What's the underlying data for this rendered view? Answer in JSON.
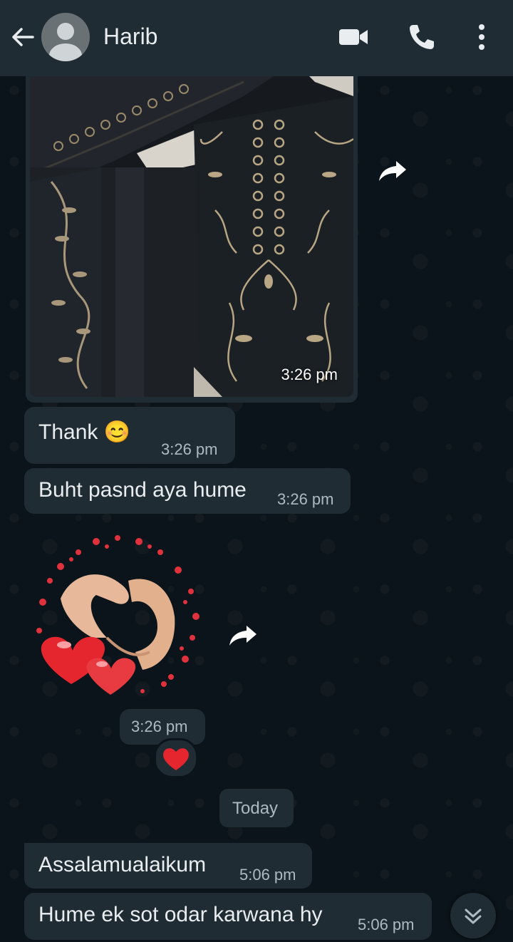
{
  "header": {
    "contact_name": "Harib",
    "icons": [
      "back-arrow-icon",
      "avatar",
      "video-call-icon",
      "voice-call-icon",
      "more-options-icon"
    ]
  },
  "messages": [
    {
      "type": "image",
      "time": "3:26 pm",
      "description_icon": "embroidered-fabric-photo"
    },
    {
      "type": "text",
      "text": "Thank 😊",
      "time": "3:26 pm"
    },
    {
      "type": "text",
      "text": "Buht pasnd aya hume",
      "time": "3:26 pm"
    },
    {
      "type": "sticker",
      "time": "3:26 pm",
      "reaction": "❤️"
    },
    {
      "type": "text",
      "text": "Assalamualaikum",
      "time": "5:06 pm"
    },
    {
      "type": "text",
      "text": "Hume ek sot odar karwana hy",
      "time": "5:06 pm"
    }
  ],
  "date_divider": "Today",
  "colors": {
    "background": "#0b141a",
    "header": "#1f2c34",
    "bubble_incoming": "#1f2c34",
    "text_primary": "#e9edef",
    "text_secondary": "#aebac1"
  }
}
